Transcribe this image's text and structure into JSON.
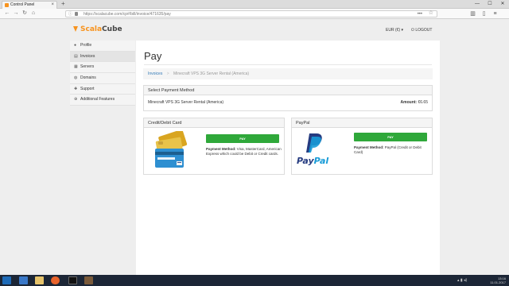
{
  "browser": {
    "tab_title": "Control Panel",
    "url": "https://scalacube.com/cp#/bill/invoice/471635/pay",
    "url_placeholder": "",
    "new_tab_label": "+",
    "close_tab_label": "×"
  },
  "header": {
    "logo_part1": "Scala",
    "logo_part2": "Cube",
    "currency": "EUR (€) ▾",
    "logout": "LOGOUT"
  },
  "sidebar": {
    "items": [
      {
        "label": "Profile",
        "icon": "user-icon"
      },
      {
        "label": "Invoices",
        "icon": "invoice-icon"
      },
      {
        "label": "Servers",
        "icon": "server-icon"
      },
      {
        "label": "Domains",
        "icon": "globe-icon"
      },
      {
        "label": "Support",
        "icon": "support-icon"
      },
      {
        "label": "Additional Features",
        "icon": "plus-icon"
      }
    ]
  },
  "main": {
    "title": "Pay",
    "breadcrumb": {
      "link": "Invoices",
      "separator": ">",
      "current": "Minecraft VPS 3G Server Rental (America)"
    },
    "method_panel": {
      "heading": "Select Payment Method",
      "service": "Minecraft VPS 3G Server Rental (America)",
      "amount_label": "Amount:",
      "amount_value": "€6.65"
    },
    "card_option": {
      "heading": "Credit/Debit Card",
      "button": "PAY",
      "method_label": "Payment Method:",
      "method_text": "Visa, MasterCard, American Express which could be Debit or Credit cards."
    },
    "paypal_option": {
      "heading": "PayPal",
      "button": "PAY",
      "logo_text_1": "Pay",
      "logo_text_2": "Pal",
      "method_label": "Payment Method:",
      "method_text": "PayPal (Credit or Debit Card)"
    }
  },
  "taskbar": {
    "time": "13:16",
    "date": "11.01.2017"
  },
  "colors": {
    "accent": "#f7931e",
    "pay_button": "#2fa83a",
    "paypal_dark": "#253b80",
    "paypal_light": "#179bd7",
    "link": "#337ab7"
  }
}
